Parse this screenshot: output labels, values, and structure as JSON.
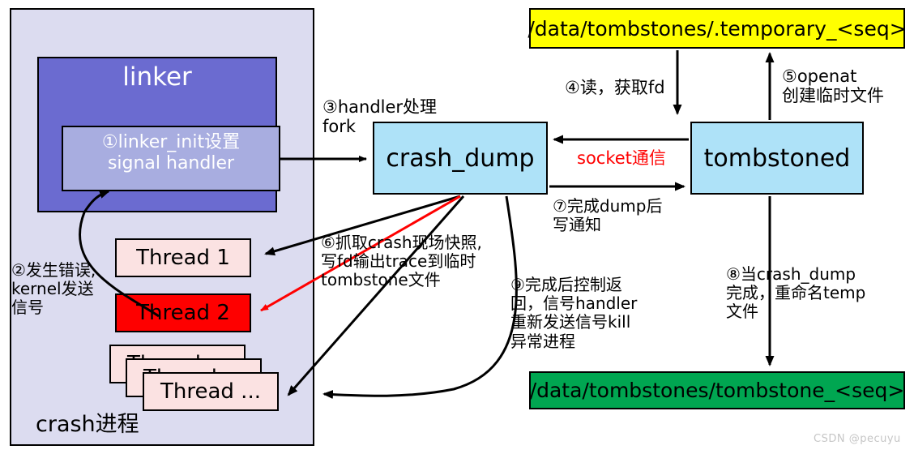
{
  "diagram": {
    "title_watermark": "CSDN @pecuyu",
    "colors": {
      "process_bg": "#dcdcf0",
      "linker_bg": "#6b6bd0",
      "handler_bg": "#a8ade0",
      "thread_bg": "#fbe2e2",
      "thread_crash_bg": "#fe0000",
      "service_bg": "#aee2f8",
      "temp_file_bg": "#ffff00",
      "final_file_bg": "#00a651",
      "socket_text": "#ff0000"
    }
  },
  "crash_process": {
    "title": "crash进程",
    "linker": {
      "title": "linker",
      "signal_handler": "①linker_init设置\nsignal handler"
    },
    "threads": [
      {
        "label": "Thread 1"
      },
      {
        "label": "Thread 2"
      },
      {
        "label": "Thread ..."
      },
      {
        "label": "Thread ..."
      },
      {
        "label": "Thread ..."
      }
    ]
  },
  "services": {
    "crash_dump": "crash_dump",
    "tombstoned": "tombstoned"
  },
  "files": {
    "temporary": "/data/tombstones/.temporary_<seq>",
    "final": "/data/tombstones/tombstone_<seq>"
  },
  "notes": {
    "n2": "②发生错误,\nkernel发送\n信号",
    "n3": "③handler处理\nfork",
    "n4": "④读，获取fd",
    "n5": "⑤openat\n创建临时文件",
    "n6": "⑥抓取crash现场快照,\n写fd输出trace到临时\ntombstone文件",
    "n7": "⑦完成dump后\n写通知",
    "n8": "⑧当crash_dump\n完成，重命名temp\n文件",
    "n9": "⑨完成后控制返\n回，信号handler\n重新发送信号kill\n异常进程",
    "socket": "socket通信"
  }
}
